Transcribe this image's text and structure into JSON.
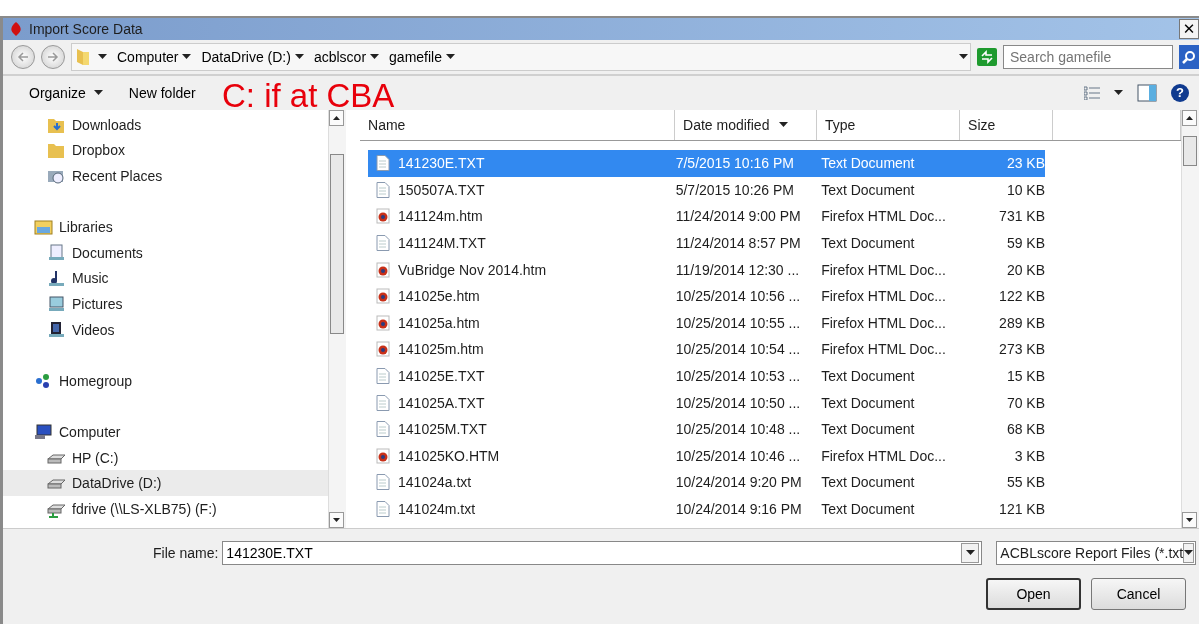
{
  "window": {
    "title": "Import Score Data",
    "close": "✕"
  },
  "address": {
    "crumbs": [
      "Computer",
      "DataDrive (D:)",
      "acblscor",
      "gamefile"
    ]
  },
  "search": {
    "placeholder": "Search gamefile"
  },
  "toolbar": {
    "help": "?",
    "buttons": [
      {
        "label": "Organize",
        "menu": true
      },
      {
        "label": "New folder",
        "menu": false
      }
    ]
  },
  "annotation": "C: if at CBA",
  "sidebar": {
    "items": [
      {
        "children": [
          {
            "label": "Downloads",
            "kind": "downloads",
            "selected": false
          },
          {
            "label": "Dropbox",
            "kind": "folder",
            "selected": false
          },
          {
            "label": "Recent Places",
            "kind": "recent",
            "selected": false
          }
        ]
      },
      {
        "label": "Libraries",
        "kind": "libraries",
        "selected": false,
        "children": [
          {
            "label": "Documents",
            "kind": "documents",
            "selected": false
          },
          {
            "label": "Music",
            "kind": "music",
            "selected": false
          },
          {
            "label": "Pictures",
            "kind": "pictures",
            "selected": false
          },
          {
            "label": "Videos",
            "kind": "videos",
            "selected": false
          }
        ]
      },
      {
        "label": "Homegroup",
        "kind": "homegroup",
        "selected": false
      },
      {
        "label": "Computer",
        "kind": "computer",
        "selected": false,
        "children": [
          {
            "label": "HP (C:)",
            "kind": "drive",
            "selected": false
          },
          {
            "label": "DataDrive (D:)",
            "kind": "drive",
            "selected": true
          },
          {
            "label": "fdrive (\\\\LS-XLB75) (F:)",
            "kind": "netdrive",
            "selected": false
          }
        ]
      }
    ]
  },
  "table": {
    "columns": [
      {
        "label": "Name",
        "sorted": false
      },
      {
        "label": "Date modified",
        "sorted": true
      },
      {
        "label": "Type",
        "sorted": false
      },
      {
        "label": "Size",
        "sorted": false
      }
    ],
    "rows": [
      {
        "name": "141230E.TXT",
        "date": "7/5/2015 10:16 PM",
        "type": "Text Document",
        "size": "23 KB",
        "kind": "text",
        "selected": true
      },
      {
        "name": "150507A.TXT",
        "date": "5/7/2015 10:26 PM",
        "type": "Text Document",
        "size": "10 KB",
        "kind": "text",
        "selected": false
      },
      {
        "name": "141124m.htm",
        "date": "11/24/2014 9:00 PM",
        "type": "Firefox HTML Doc...",
        "size": "731 KB",
        "kind": "html",
        "selected": false
      },
      {
        "name": "141124M.TXT",
        "date": "11/24/2014 8:57 PM",
        "type": "Text Document",
        "size": "59 KB",
        "kind": "text",
        "selected": false
      },
      {
        "name": "VuBridge Nov 2014.htm",
        "date": "11/19/2014 12:30 ...",
        "type": "Firefox HTML Doc...",
        "size": "20 KB",
        "kind": "html",
        "selected": false
      },
      {
        "name": "141025e.htm",
        "date": "10/25/2014 10:56 ...",
        "type": "Firefox HTML Doc...",
        "size": "122 KB",
        "kind": "html",
        "selected": false
      },
      {
        "name": "141025a.htm",
        "date": "10/25/2014 10:55 ...",
        "type": "Firefox HTML Doc...",
        "size": "289 KB",
        "kind": "html",
        "selected": false
      },
      {
        "name": "141025m.htm",
        "date": "10/25/2014 10:54 ...",
        "type": "Firefox HTML Doc...",
        "size": "273 KB",
        "kind": "html",
        "selected": false
      },
      {
        "name": "141025E.TXT",
        "date": "10/25/2014 10:53 ...",
        "type": "Text Document",
        "size": "15 KB",
        "kind": "text",
        "selected": false
      },
      {
        "name": "141025A.TXT",
        "date": "10/25/2014 10:50 ...",
        "type": "Text Document",
        "size": "70 KB",
        "kind": "text",
        "selected": false
      },
      {
        "name": "141025M.TXT",
        "date": "10/25/2014 10:48 ...",
        "type": "Text Document",
        "size": "68 KB",
        "kind": "text",
        "selected": false
      },
      {
        "name": "141025KO.HTM",
        "date": "10/25/2014 10:46 ...",
        "type": "Firefox HTML Doc...",
        "size": "3 KB",
        "kind": "html",
        "selected": false
      },
      {
        "name": "141024a.txt",
        "date": "10/24/2014 9:20 PM",
        "type": "Text Document",
        "size": "55 KB",
        "kind": "text",
        "selected": false
      },
      {
        "name": "141024m.txt",
        "date": "10/24/2014 9:16 PM",
        "type": "Text Document",
        "size": "121 KB",
        "kind": "text",
        "selected": false
      }
    ]
  },
  "filename": {
    "label": "File name:",
    "value": "141230E.TXT"
  },
  "filter": {
    "value": "ACBLscore Report Files (*.txt"
  },
  "buttons": [
    {
      "label": "Open",
      "default": true
    },
    {
      "label": "Cancel",
      "default": false
    }
  ]
}
